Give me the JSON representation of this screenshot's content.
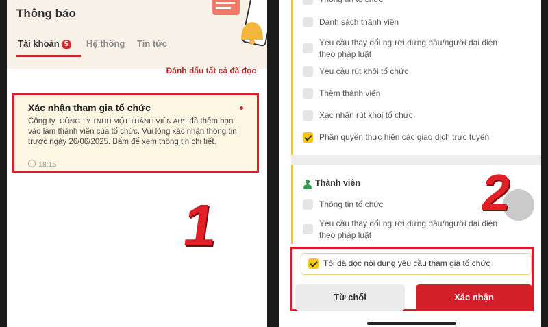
{
  "left": {
    "title": "Thông báo",
    "tabs": [
      {
        "label": "Tài khoản",
        "badge": "5",
        "active": true
      },
      {
        "label": "Hệ thống"
      },
      {
        "label": "Tin tức"
      }
    ],
    "mark_all": "Đánh dấu tất cả đã đọc",
    "notification": {
      "title": "Xác nhận tham gia tổ chức",
      "body_prefix": "Công ty",
      "company": "CÔNG TY TNHH MỘT THÀNH VIÊN AB*",
      "body_rest": "đã thêm bạn vào làm thành viên của tổ chức. Vui lòng xác nhận thông tin trước ngày 26/06/2025. Bấm để xem thông tin chi tiết.",
      "time": "18:15"
    },
    "step_number": "1"
  },
  "right": {
    "top_cut_item": "Thông tin tổ chức",
    "permissions": [
      {
        "label": "Danh sách thành viên",
        "checked": false
      },
      {
        "label": "Yêu cầu thay đổi người đứng đầu/người đại diện",
        "label2": "theo pháp luật",
        "checked": false
      },
      {
        "label": "Yêu cầu rút khỏi tổ chức",
        "checked": false
      },
      {
        "label": "Thêm thành viên",
        "checked": false
      },
      {
        "label": "Xác nhận rút khỏi tổ chức",
        "checked": false
      },
      {
        "label": "Phân quyền thực hiện các giao dịch trực tuyến",
        "checked": true
      }
    ],
    "member_section": {
      "title": "Thành viên",
      "items": [
        {
          "label": "Thông tin tổ chức",
          "checked": false
        },
        {
          "label": "Yêu cầu thay đổi người đứng đầu/người đại diện",
          "label2": "theo pháp luật",
          "checked": false
        }
      ]
    },
    "agree_label": "Tôi đã đọc nội dung yêu cầu tham gia tổ chức",
    "reject_button": "Từ chối",
    "confirm_button": "Xác nhận",
    "step_number": "2"
  },
  "colors": {
    "accent": "#d32028",
    "checkbox": "#f5c518",
    "header_bg": "#f7f1e8"
  }
}
